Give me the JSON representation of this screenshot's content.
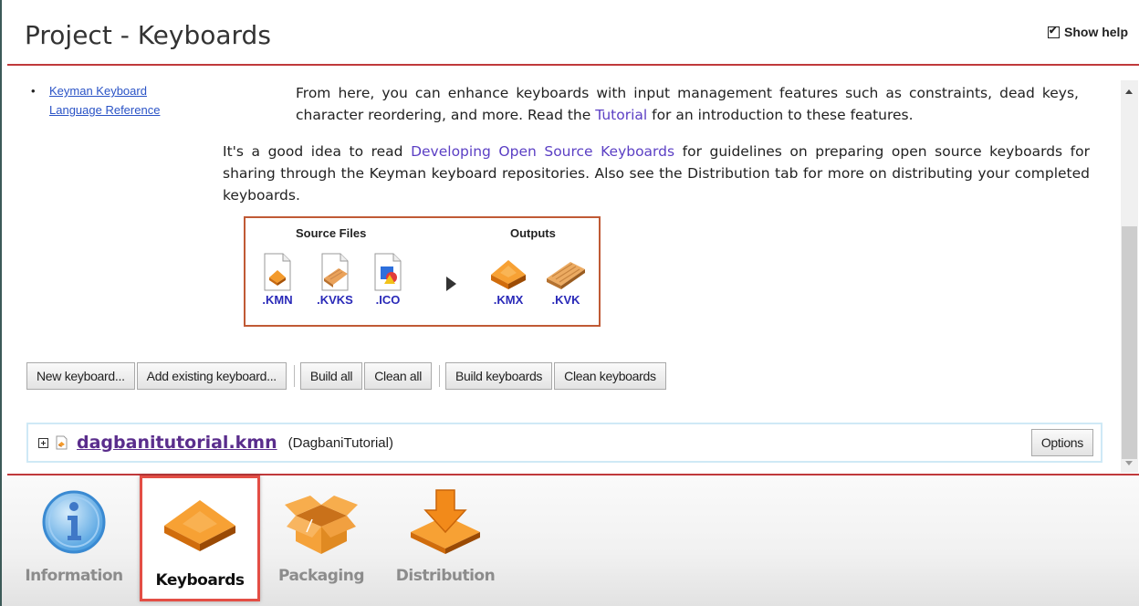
{
  "header": {
    "title": "Project - Keyboards",
    "show_help_label": "Show help",
    "show_help_checked": true
  },
  "side_links": [
    {
      "label": "Keyman Keyboard Language Reference"
    }
  ],
  "help": {
    "para1_text1": "From here, you can enhance keyboards with input management features such as constraints, dead keys, character reordering, and more. Read the ",
    "para1_link": "Tutorial",
    "para1_text2": " for an introduction to these features.",
    "para2_text1": "It's a good idea to read ",
    "para2_link": "Developing Open Source Keyboards",
    "para2_text2": " for guidelines on preparing open source keyboards for sharing through the Keyman keyboard repositories. Also see the Distribution tab for more on distributing your completed keyboards."
  },
  "diagram": {
    "source_heading": "Source Files",
    "outputs_heading": "Outputs",
    "sources": [
      {
        "ext": ".KMN",
        "icon": "kmn-file-icon"
      },
      {
        "ext": ".KVKS",
        "icon": "kvks-file-icon"
      },
      {
        "ext": ".ICO",
        "icon": "ico-file-icon"
      }
    ],
    "outputs": [
      {
        "ext": ".KMX",
        "icon": "kmx-keycap-icon"
      },
      {
        "ext": ".KVK",
        "icon": "kvk-keyboard-icon"
      }
    ]
  },
  "buttons": {
    "new_keyboard": "New keyboard...",
    "add_existing": "Add existing keyboard...",
    "build_all": "Build all",
    "clean_all": "Clean all",
    "build_keyboards": "Build keyboards",
    "clean_keyboards": "Clean keyboards"
  },
  "keyboard_item": {
    "file_name": "dagbanitutorial.kmn",
    "keyboard_id": "(DagbaniTutorial)",
    "options_label": "Options"
  },
  "tabs": [
    {
      "label": "Information",
      "icon": "info-icon",
      "active": false
    },
    {
      "label": "Keyboards",
      "icon": "keyboard-key-icon",
      "active": true
    },
    {
      "label": "Packaging",
      "icon": "open-box-icon",
      "active": false
    },
    {
      "label": "Distribution",
      "icon": "download-arrow-icon",
      "active": false
    }
  ],
  "colors": {
    "accent_red": "#c0393b",
    "link_blue": "#2a53c6",
    "link_purple": "#5b3fc4",
    "keyboard_orange": "#f08a1c",
    "ext_blue": "#2929b8"
  }
}
